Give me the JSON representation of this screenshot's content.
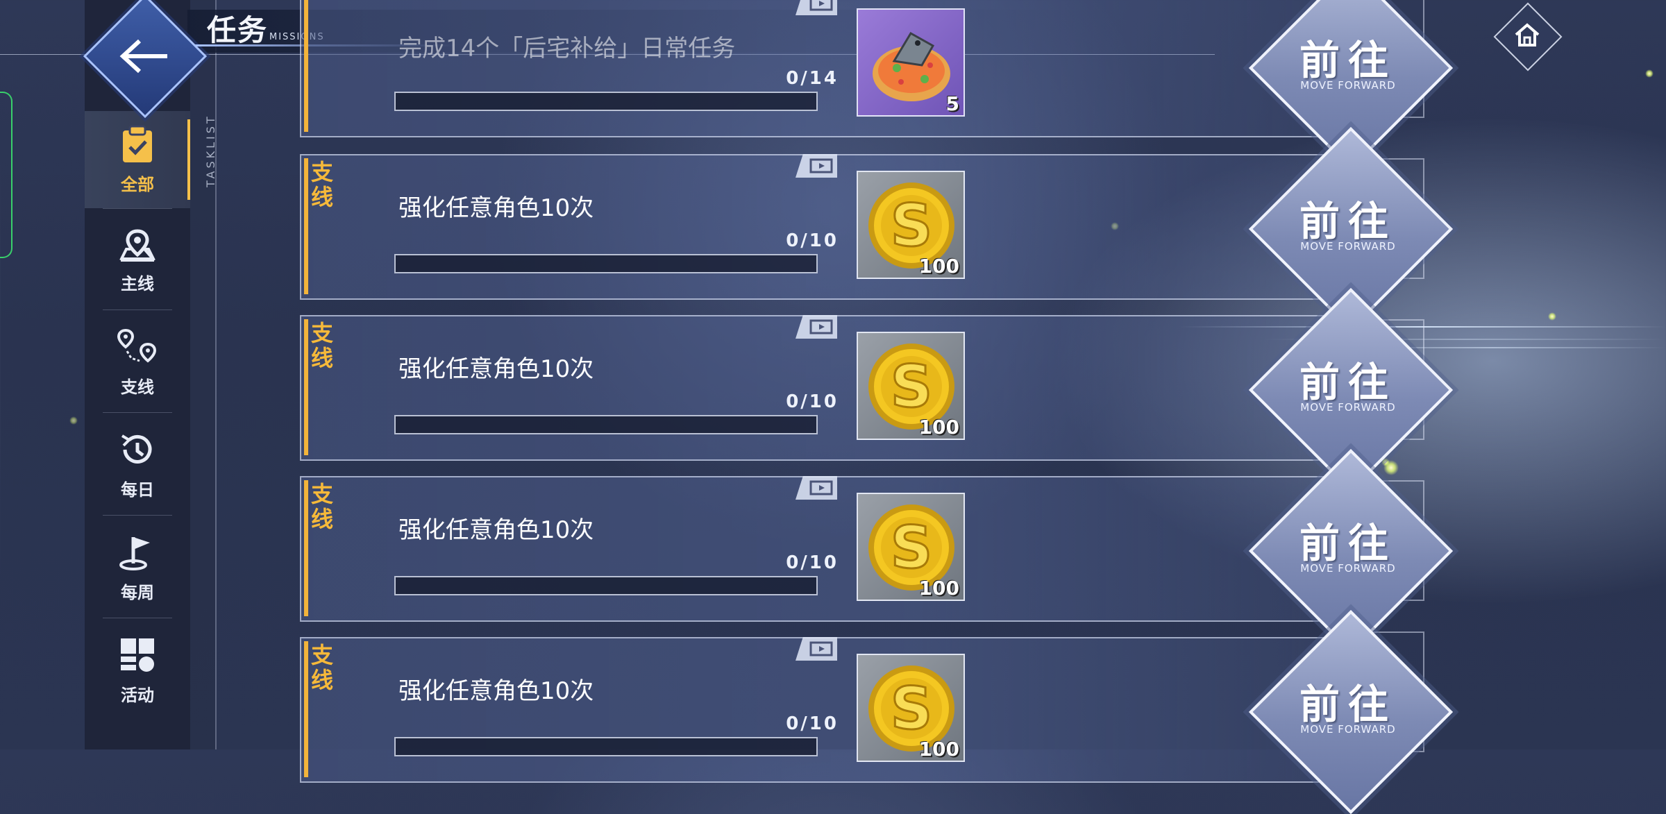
{
  "header": {
    "title": "任务",
    "subtitle": "MISSIONS",
    "side_label": "TASKLIST"
  },
  "sidebar": {
    "items": [
      {
        "label": "全部",
        "icon": "clipboard-check-icon",
        "active": true
      },
      {
        "label": "主线",
        "icon": "map-pin-icon",
        "active": false
      },
      {
        "label": "支线",
        "icon": "route-pins-icon",
        "active": false
      },
      {
        "label": "每日",
        "icon": "history-clock-icon",
        "active": false
      },
      {
        "label": "每周",
        "icon": "flag-icon",
        "active": false
      },
      {
        "label": "活动",
        "icon": "blocks-icon",
        "active": false
      }
    ]
  },
  "tasks": [
    {
      "tag": "",
      "title": "完成14个「后宅补给」日常任务",
      "progress": "0/14",
      "progress_fraction": 0,
      "reward_qty": "5",
      "reward_icon": "pizza-icon",
      "button": "前往",
      "button_sub": "MOVE FORWARD"
    },
    {
      "tag": "支线",
      "title": "强化任意角色10次",
      "progress": "0/10",
      "progress_fraction": 0,
      "reward_qty": "100",
      "reward_icon": "gold-coin-icon",
      "button": "前往",
      "button_sub": "MOVE FORWARD"
    },
    {
      "tag": "支线",
      "title": "强化任意角色10次",
      "progress": "0/10",
      "progress_fraction": 0,
      "reward_qty": "100",
      "reward_icon": "gold-coin-icon",
      "button": "前往",
      "button_sub": "MOVE FORWARD"
    },
    {
      "tag": "支线",
      "title": "强化任意角色10次",
      "progress": "0/10",
      "progress_fraction": 0,
      "reward_qty": "100",
      "reward_icon": "gold-coin-icon",
      "button": "前往",
      "button_sub": "MOVE FORWARD"
    },
    {
      "tag": "支线",
      "title": "强化任意角色10次",
      "progress": "0/10",
      "progress_fraction": 0,
      "reward_qty": "100",
      "reward_icon": "gold-coin-icon",
      "button": "前往",
      "button_sub": "MOVE FORWARD"
    }
  ],
  "colors": {
    "accent": "#f3b43b",
    "background": "#2e3857",
    "button": "#8a96bf"
  }
}
